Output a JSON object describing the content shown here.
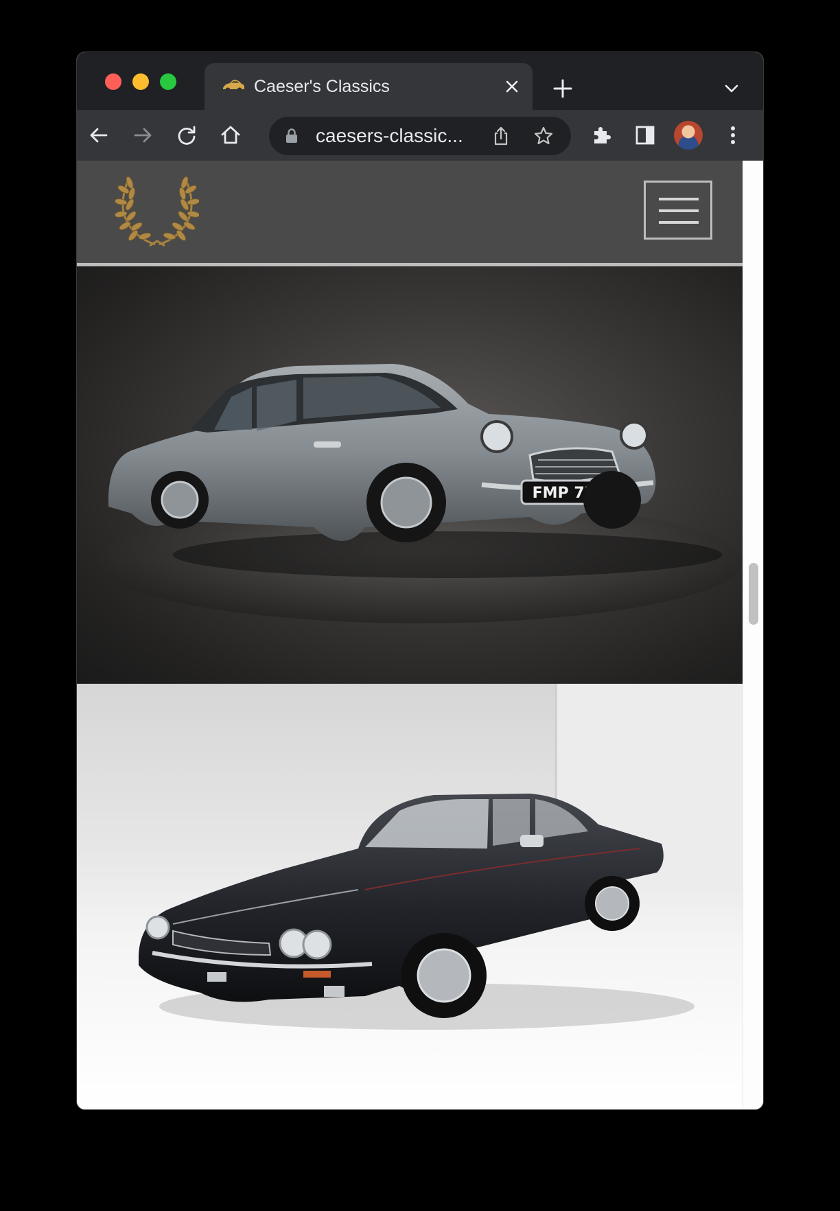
{
  "browser": {
    "tab": {
      "title": "Caeser's Classics",
      "favicon": "classic-car-favicon"
    },
    "address_bar": {
      "url": "caesers-classic...",
      "secure": true
    },
    "toolbar_icons": [
      "back-icon",
      "forward-icon",
      "reload-icon",
      "home-icon",
      "share-icon",
      "bookmark-star-icon",
      "extensions-icon",
      "side-panel-icon",
      "profile-avatar",
      "menu-icon"
    ]
  },
  "site": {
    "logo": "laurel-wreath-logo",
    "menu": "hamburger-menu-icon",
    "header_color": "#4a4a4a",
    "logo_color": "#b08a45"
  },
  "gallery": [
    {
      "name": "gray-classic-coupe",
      "plate": "FMP 7B",
      "body_color": "#8a9196"
    },
    {
      "name": "black-grand-tourer",
      "body_color": "#1f2126"
    }
  ]
}
